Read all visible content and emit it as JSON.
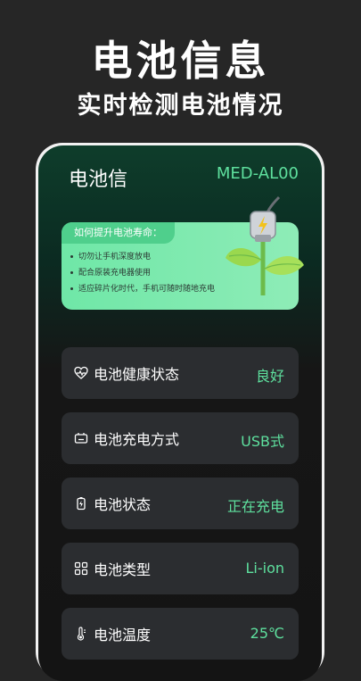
{
  "promo": {
    "title": "电池信息",
    "subtitle": "实时检测电池情况"
  },
  "header": {
    "title": "电池信",
    "model": "MED-AL00"
  },
  "tips": {
    "title": "如何提升电池寿命：",
    "items": [
      "切勿让手机深度放电",
      "配合原装充电器使用",
      "适应碎片化时代，手机可随时随地充电"
    ]
  },
  "rows": [
    {
      "icon": "heart-pulse-icon",
      "label": "电池健康状态",
      "value": "良好"
    },
    {
      "icon": "battery-charge-icon",
      "label": "电池充电方式",
      "value": "USB式"
    },
    {
      "icon": "battery-status-icon",
      "label": "电池状态",
      "value": "正在充电"
    },
    {
      "icon": "grid-icon",
      "label": "电池类型",
      "value": "Li-ion"
    },
    {
      "icon": "thermometer-icon",
      "label": "电池温度",
      "value": "25℃"
    }
  ],
  "colors": {
    "accent": "#5ee09e",
    "background": "#262626",
    "card": "#2b2d30",
    "tips_bg": "#7ae8ad"
  }
}
